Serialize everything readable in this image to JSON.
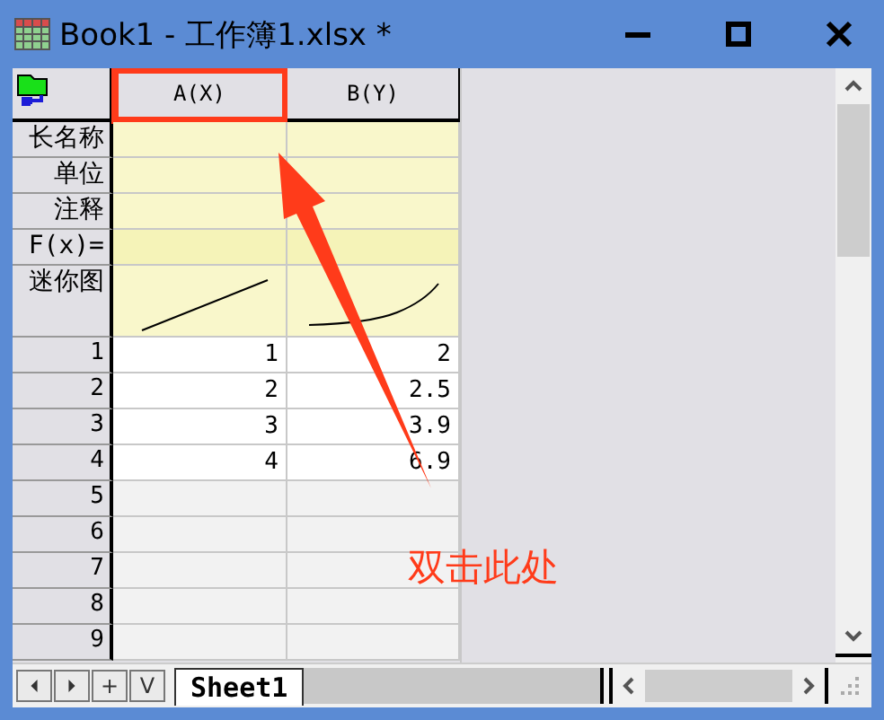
{
  "window": {
    "title": "Book1 - 工作簿1.xlsx *"
  },
  "columns": [
    {
      "label": "A(X)",
      "highlighted": true
    },
    {
      "label": "B(Y)",
      "highlighted": false
    }
  ],
  "label_rows": [
    {
      "label": "长名称",
      "kind": "text"
    },
    {
      "label": "单位",
      "kind": "text"
    },
    {
      "label": "注释",
      "kind": "text"
    },
    {
      "label": "F(x)=",
      "kind": "formula"
    },
    {
      "label": "迷你图",
      "kind": "sparkline"
    }
  ],
  "rows": [
    {
      "number": "1",
      "cells": [
        "1",
        "2"
      ]
    },
    {
      "number": "2",
      "cells": [
        "2",
        "2.5"
      ]
    },
    {
      "number": "3",
      "cells": [
        "3",
        "3.9"
      ]
    },
    {
      "number": "4",
      "cells": [
        "4",
        "6.9"
      ]
    },
    {
      "number": "5"
    },
    {
      "number": "6"
    },
    {
      "number": "7"
    },
    {
      "number": "8"
    },
    {
      "number": "9"
    }
  ],
  "sheet_buttons": [
    "+",
    "V"
  ],
  "sheet_tabs": [
    {
      "label": "Sheet1",
      "selected": true
    }
  ],
  "annotation": {
    "text": "双击此处"
  }
}
